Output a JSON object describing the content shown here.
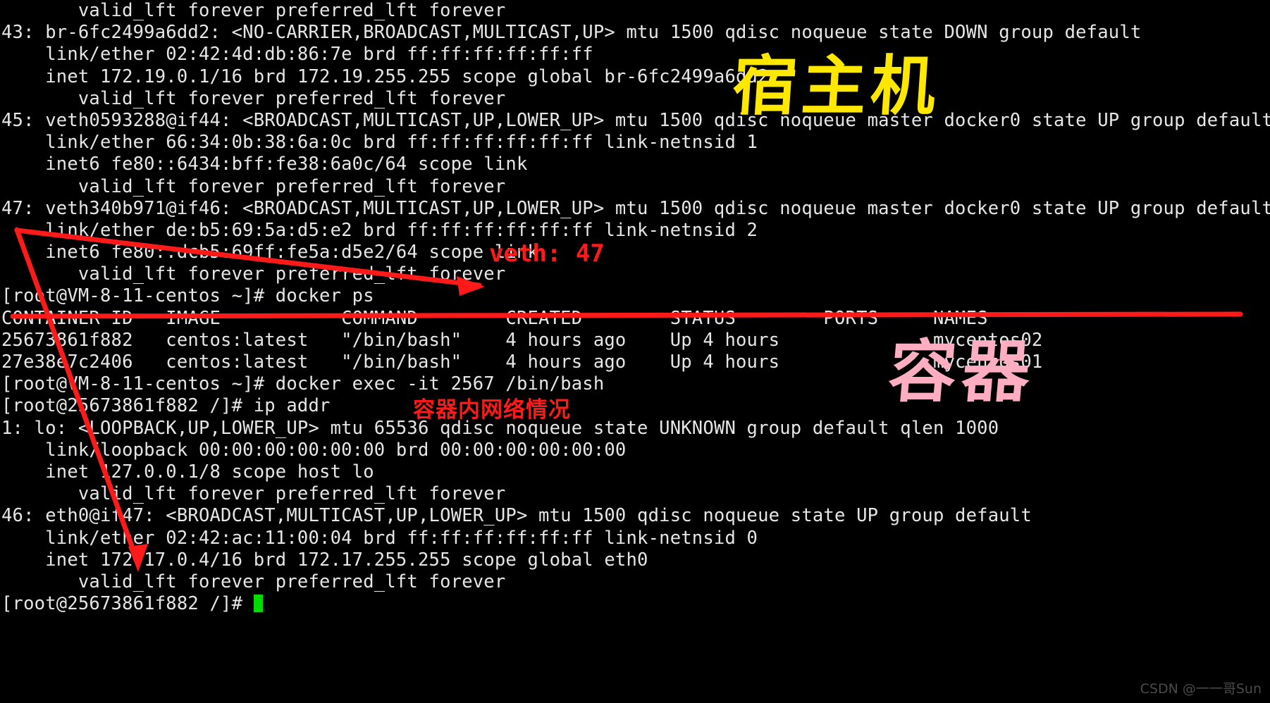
{
  "terminal": {
    "background": "#000000",
    "foreground": "#e6e6e6",
    "cursor_color": "#00dd00",
    "lines": [
      "       valid_lft forever preferred_lft forever",
      "43: br-6fc2499a6dd2: <NO-CARRIER,BROADCAST,MULTICAST,UP> mtu 1500 qdisc noqueue state DOWN group default",
      "    link/ether 02:42:4d:db:86:7e brd ff:ff:ff:ff:ff:ff",
      "    inet 172.19.0.1/16 brd 172.19.255.255 scope global br-6fc2499a6dd2",
      "       valid_lft forever preferred_lft forever",
      "45: veth0593288@if44: <BROADCAST,MULTICAST,UP,LOWER_UP> mtu 1500 qdisc noqueue master docker0 state UP group default",
      "    link/ether 66:34:0b:38:6a:0c brd ff:ff:ff:ff:ff:ff link-netnsid 1",
      "    inet6 fe80::6434:bff:fe38:6a0c/64 scope link",
      "       valid_lft forever preferred_lft forever",
      "47: veth340b971@if46: <BROADCAST,MULTICAST,UP,LOWER_UP> mtu 1500 qdisc noqueue master docker0 state UP group default",
      "    link/ether de:b5:69:5a:d5:e2 brd ff:ff:ff:ff:ff:ff link-netnsid 2",
      "    inet6 fe80::dcb5:69ff:fe5a:d5e2/64 scope link",
      "       valid_lft forever preferred_lft forever",
      "[root@VM-8-11-centos ~]# docker ps",
      "CONTAINER ID   IMAGE           COMMAND        CREATED        STATUS        PORTS     NAMES",
      "25673861f882   centos:latest   \"/bin/bash\"    4 hours ago    Up 4 hours              mycentos02",
      "27e38e7c2406   centos:latest   \"/bin/bash\"    4 hours ago    Up 4 hours              mycentos01",
      "[root@VM-8-11-centos ~]# docker exec -it 2567 /bin/bash",
      "[root@25673861f882 /]# ip addr",
      "1: lo: <LOOPBACK,UP,LOWER_UP> mtu 65536 qdisc noqueue state UNKNOWN group default qlen 1000",
      "    link/loopback 00:00:00:00:00:00 brd 00:00:00:00:00:00",
      "    inet 127.0.0.1/8 scope host lo",
      "       valid_lft forever preferred_lft forever",
      "46: eth0@if47: <BROADCAST,MULTICAST,UP,LOWER_UP> mtu 1500 qdisc noqueue state UP group default",
      "    link/ether 02:42:ac:11:00:04 brd ff:ff:ff:ff:ff:ff link-netnsid 0",
      "    inet 172.17.0.4/16 brd 172.17.255.255 scope global eth0",
      "       valid_lft forever preferred_lft forever"
    ],
    "prompt_last": "[root@25673861f882 /]# "
  },
  "commands": {
    "docker_ps": "docker ps",
    "docker_exec": "docker exec -it 2567 /bin/bash",
    "ip_addr": "ip addr"
  },
  "docker_ps_table": {
    "headers": [
      "CONTAINER ID",
      "IMAGE",
      "COMMAND",
      "CREATED",
      "STATUS",
      "PORTS",
      "NAMES"
    ],
    "rows": [
      [
        "25673861f882",
        "centos:latest",
        "\"/bin/bash\"",
        "4 hours ago",
        "Up 4 hours",
        "",
        "mycentos02"
      ],
      [
        "27e38e7c2406",
        "centos:latest",
        "\"/bin/bash\"",
        "4 hours ago",
        "Up 4 hours",
        "",
        "mycentos01"
      ]
    ]
  },
  "annotations": {
    "host_label": "宿主机",
    "host_color": "#ffe800",
    "container_label": "容器",
    "container_color": "#ffaec2",
    "veth_label": "veth: 47",
    "veth_color": "#ff1a1a",
    "container_net_label": "容器内网络情况",
    "container_net_color": "#ff1a1a",
    "divider_color": "#ff1a1a"
  },
  "watermark": {
    "text": "CSDN @一一哥Sun"
  }
}
